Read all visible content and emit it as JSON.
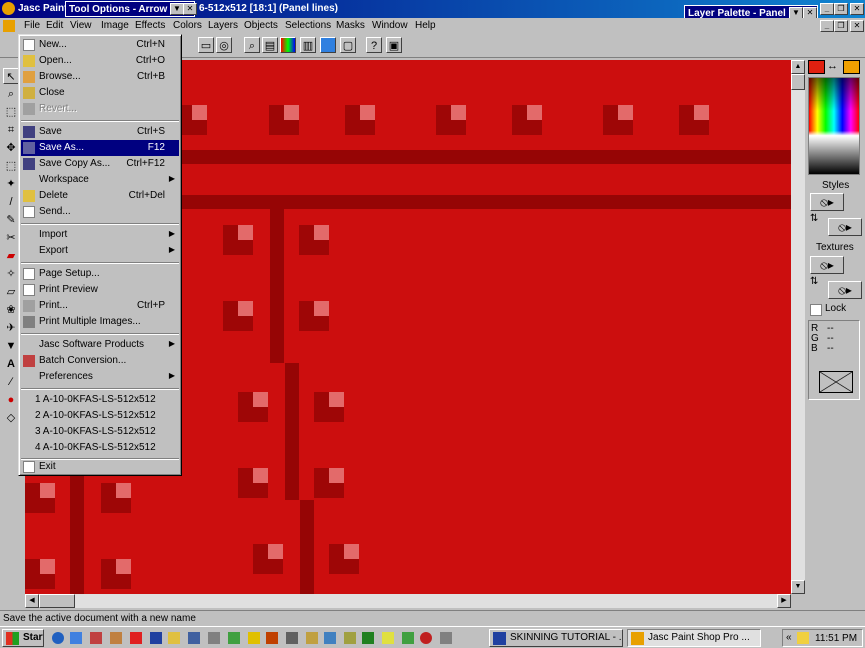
{
  "app": {
    "title_left": "Jasc Paint",
    "title_right": "6-512x512 [18:1] (Panel lines)"
  },
  "tool_options": {
    "title": "Tool Options - Arrow"
  },
  "layer_palette": {
    "title": "Layer Palette - Panel"
  },
  "menubar": [
    "File",
    "Edit",
    "View",
    "Image",
    "Effects",
    "Colors",
    "Layers",
    "Objects",
    "Selections",
    "Masks",
    "Window",
    "Help"
  ],
  "file_menu": {
    "new": {
      "label": "New...",
      "shortcut": "Ctrl+N"
    },
    "open": {
      "label": "Open...",
      "shortcut": "Ctrl+O"
    },
    "browse": {
      "label": "Browse...",
      "shortcut": "Ctrl+B"
    },
    "close": {
      "label": "Close"
    },
    "revert": {
      "label": "Revert..."
    },
    "save": {
      "label": "Save",
      "shortcut": "Ctrl+S"
    },
    "save_as": {
      "label": "Save As...",
      "shortcut": "F12"
    },
    "save_copy_as": {
      "label": "Save Copy As...",
      "shortcut": "Ctrl+F12"
    },
    "workspace": {
      "label": "Workspace"
    },
    "delete": {
      "label": "Delete",
      "shortcut": "Ctrl+Del"
    },
    "send": {
      "label": "Send..."
    },
    "import": {
      "label": "Import"
    },
    "export": {
      "label": "Export"
    },
    "page_setup": {
      "label": "Page Setup..."
    },
    "print_preview": {
      "label": "Print Preview"
    },
    "print": {
      "label": "Print...",
      "shortcut": "Ctrl+P"
    },
    "print_multiple": {
      "label": "Print Multiple Images..."
    },
    "jasc_products": {
      "label": "Jasc Software Products"
    },
    "batch": {
      "label": "Batch Conversion..."
    },
    "preferences": {
      "label": "Preferences"
    },
    "recent": [
      "1 A-10-0KFAS-LS-512x512",
      "2 A-10-0KFAS-LS-512x512",
      "3 A-10-0KFAS-LS-512x512",
      "4 A-10-0KFAS-LS-512x512"
    ],
    "exit": {
      "label": "Exit"
    }
  },
  "palette": {
    "styles_label": "Styles",
    "textures_label": "Textures",
    "lock_label": "Lock",
    "rgb": {
      "r": "R",
      "g": "G",
      "b": "B",
      "r_val": "--",
      "g_val": "--",
      "b_val": "--"
    },
    "fg_color": "#e02010",
    "bg_color": "#f0a000"
  },
  "status_text": "Save the active document with a new name",
  "taskbar": {
    "start": "Start",
    "tasks": [
      "SKINNING TUTORIAL - ...",
      "Jasc Paint Shop Pro ..."
    ],
    "clock": "11:51 PM",
    "tray_arrows": "«"
  },
  "colors": {
    "canvas_red": "#cc0e0e",
    "panel_line": "#960505",
    "rivet_dark": "#9e0606",
    "rivet_light": "#e36a6a"
  }
}
